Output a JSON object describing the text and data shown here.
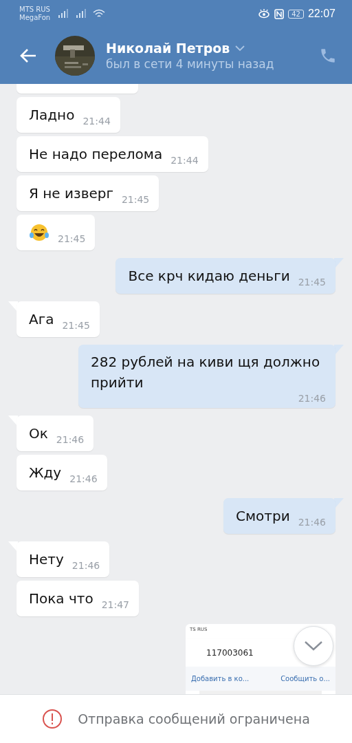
{
  "status_bar": {
    "carrier_1": "MTS RUS",
    "carrier_2": "MegaFon",
    "battery": "42",
    "time": "22:07"
  },
  "header": {
    "name": "Николай Петров",
    "status": "был в сети 4 минуты назад"
  },
  "messages": [
    {
      "kind": "fragment",
      "outgoing": false,
      "tail": false
    },
    {
      "kind": "text",
      "outgoing": false,
      "tail": false,
      "text": "Ладно",
      "time": "21:44"
    },
    {
      "kind": "text",
      "outgoing": false,
      "tail": false,
      "text": "Не надо перелома",
      "time": "21:44"
    },
    {
      "kind": "text",
      "outgoing": false,
      "tail": false,
      "text": "Я не изверг",
      "time": "21:45"
    },
    {
      "kind": "emoji",
      "outgoing": false,
      "tail": false,
      "time": "21:45"
    },
    {
      "kind": "text",
      "outgoing": true,
      "tail": true,
      "text": "Все крч кидаю деньги",
      "time": "21:45"
    },
    {
      "kind": "text",
      "outgoing": false,
      "tail": true,
      "text": "Ага",
      "time": "21:45"
    },
    {
      "kind": "text",
      "outgoing": true,
      "tail": true,
      "text": "282 рублей на киви щя должно прийти",
      "time": "21:46"
    },
    {
      "kind": "text",
      "outgoing": false,
      "tail": true,
      "text": "Ок",
      "time": "21:46"
    },
    {
      "kind": "text",
      "outgoing": false,
      "tail": false,
      "text": "Жду",
      "time": "21:46"
    },
    {
      "kind": "text",
      "outgoing": true,
      "tail": true,
      "text": "Смотри",
      "time": "21:46"
    },
    {
      "kind": "text",
      "outgoing": false,
      "tail": true,
      "text": "Нету",
      "time": "21:46"
    },
    {
      "kind": "text",
      "outgoing": false,
      "tail": false,
      "text": "Пока что",
      "time": "21:47"
    },
    {
      "kind": "screenshot",
      "outgoing": true,
      "tail": false,
      "carrier": "TS RUS",
      "number": "117003061",
      "actions": [
        "Добавить в ко...",
        "Сообщить о..."
      ]
    }
  ],
  "notice": "Отправка сообщений ограничена"
}
